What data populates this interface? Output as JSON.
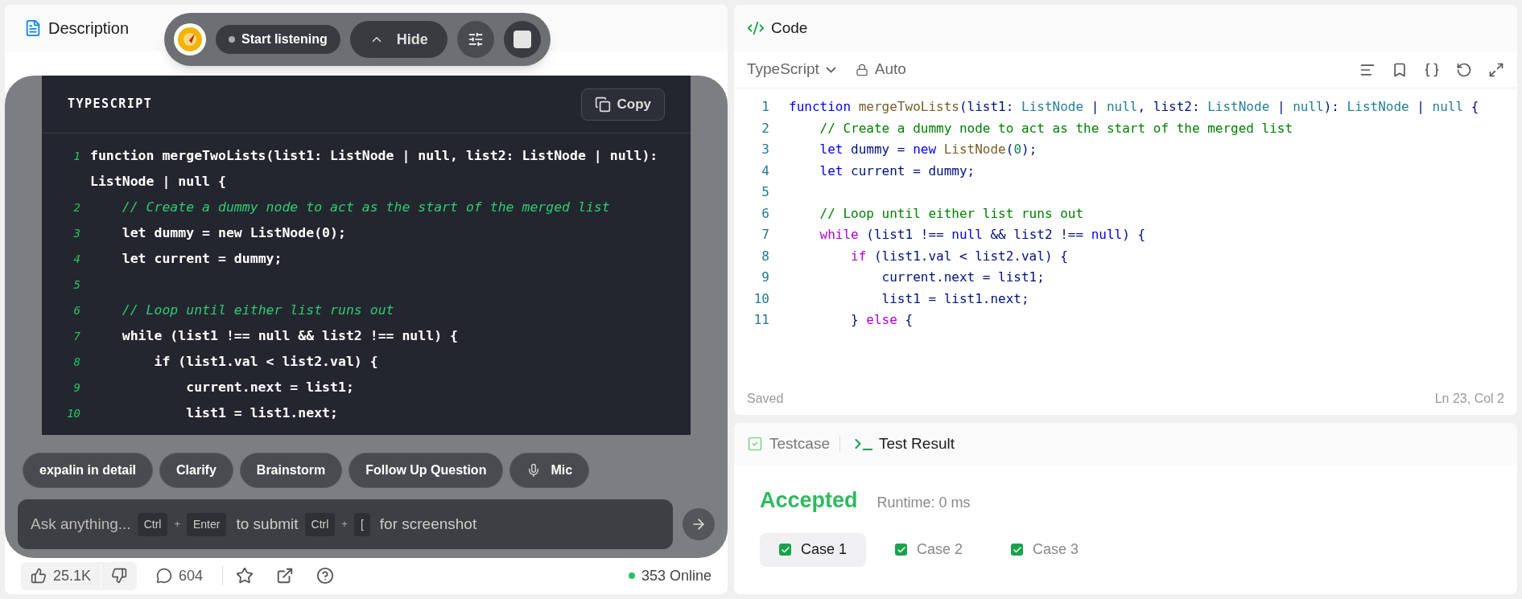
{
  "description_panel": {
    "tabs": [
      {
        "label": "Description",
        "selected": true
      }
    ],
    "footer": {
      "likes": "25.1K",
      "comments": "604",
      "online": "353 Online"
    }
  },
  "assistant": {
    "toolbar": {
      "listen_button": "Start listening",
      "hide_button": "Hide"
    },
    "code_block": {
      "language": "TYPESCRIPT",
      "copy_button": "Copy",
      "lines": [
        {
          "num": "1",
          "text": "function mergeTwoLists(list1: ListNode | null, list2: ListNode | null): ListNode | null {",
          "kind": "code"
        },
        {
          "num": "2",
          "text": "    // Create a dummy node to act as the start of the merged list",
          "kind": "comment"
        },
        {
          "num": "3",
          "text": "    let dummy = new ListNode(0);",
          "kind": "code"
        },
        {
          "num": "4",
          "text": "    let current = dummy;",
          "kind": "code"
        },
        {
          "num": "5"
        },
        {
          "num": "6",
          "text": "    // Loop until either list runs out",
          "kind": "comment"
        },
        {
          "num": "7",
          "text": "    while (list1 !== null && list2 !== null) {",
          "kind": "code"
        },
        {
          "num": "8",
          "text": "        if (list1.val < list2.val) {",
          "kind": "code"
        },
        {
          "num": "9",
          "text": "            current.next = list1;",
          "kind": "code"
        },
        {
          "num": "10",
          "text": "            list1 = list1.next;",
          "kind": "code"
        }
      ]
    },
    "chips": [
      {
        "label": "expalin in detail",
        "kind": "text"
      },
      {
        "label": "Clarify",
        "kind": "text"
      },
      {
        "label": "Brainstorm",
        "kind": "text"
      },
      {
        "label": "Follow Up Question",
        "kind": "text"
      },
      {
        "label": "Mic",
        "kind": "mic"
      }
    ],
    "input": {
      "placeholder": "Ask anything...",
      "hints": [
        {
          "text": "Ctrl",
          "kind": "key"
        },
        {
          "text": "+",
          "kind": "plus"
        },
        {
          "text": "Enter",
          "kind": "key"
        },
        {
          "text": "to submit",
          "kind": "label"
        },
        {
          "text": "Ctrl",
          "kind": "key"
        },
        {
          "text": "+",
          "kind": "plus"
        },
        {
          "text": "[",
          "kind": "key"
        },
        {
          "text": "for screenshot",
          "kind": "label"
        }
      ]
    }
  },
  "code_panel": {
    "title": "Code",
    "language": "TypeScript",
    "mode": "Auto",
    "lines": [
      {
        "num": "1",
        "tokens": [
          {
            "text": "function ",
            "kind": "kw"
          },
          {
            "text": "mergeTwoLists",
            "kind": "fn"
          },
          {
            "text": "(list1: ",
            "kind": "plain"
          },
          {
            "text": "ListNode",
            "kind": "type"
          },
          {
            "text": " | ",
            "kind": "plain"
          },
          {
            "text": "null",
            "kind": "type"
          },
          {
            "text": ", list2: ",
            "kind": "plain"
          },
          {
            "text": "ListNode",
            "kind": "type"
          },
          {
            "text": " | ",
            "kind": "plain"
          },
          {
            "text": "null",
            "kind": "type"
          },
          {
            "text": "): ",
            "kind": "plain"
          },
          {
            "text": "ListNode",
            "kind": "type"
          },
          {
            "text": " | ",
            "kind": "plain"
          },
          {
            "text": "null",
            "kind": "type"
          },
          {
            "text": " {",
            "kind": "plain"
          }
        ]
      },
      {
        "num": "2",
        "tokens": [
          {
            "text": "    // Create a dummy node to act as the start of the merged list",
            "kind": "comment"
          }
        ]
      },
      {
        "num": "3",
        "tokens": [
          {
            "text": "    let",
            "kind": "kw"
          },
          {
            "text": " dummy = ",
            "kind": "plain"
          },
          {
            "text": "new ",
            "kind": "kw"
          },
          {
            "text": "ListNode",
            "kind": "fn"
          },
          {
            "text": "(",
            "kind": "plain"
          },
          {
            "text": "0",
            "kind": "num"
          },
          {
            "text": ");",
            "kind": "plain"
          }
        ]
      },
      {
        "num": "4",
        "tokens": [
          {
            "text": "    let",
            "kind": "kw"
          },
          {
            "text": " current = dummy;",
            "kind": "plain"
          }
        ]
      },
      {
        "num": "5"
      },
      {
        "num": "6",
        "tokens": [
          {
            "text": "    // Loop until either list runs out",
            "kind": "comment"
          }
        ]
      },
      {
        "num": "7",
        "tokens": [
          {
            "text": "    while",
            "kind": "ctrl"
          },
          {
            "text": " (list1 !== ",
            "kind": "plain"
          },
          {
            "text": "null",
            "kind": "kw"
          },
          {
            "text": " && list2 !== ",
            "kind": "plain"
          },
          {
            "text": "null",
            "kind": "kw"
          },
          {
            "text": ") {",
            "kind": "plain"
          }
        ]
      },
      {
        "num": "8",
        "tokens": [
          {
            "text": "        if",
            "kind": "ctrl"
          },
          {
            "text": " (list1.val < list2.val) {",
            "kind": "plain"
          }
        ]
      },
      {
        "num": "9",
        "tokens": [
          {
            "text": "            current.next = list1;",
            "kind": "plain"
          }
        ]
      },
      {
        "num": "10",
        "tokens": [
          {
            "text": "            list1 = list1.next;",
            "kind": "plain"
          }
        ]
      },
      {
        "num": "11",
        "tokens": [
          {
            "text": "        } ",
            "kind": "plain"
          },
          {
            "text": "else",
            "kind": "ctrl"
          },
          {
            "text": " {",
            "kind": "plain"
          }
        ]
      }
    ],
    "status": "Saved",
    "cursor": "Ln 23, Col 2"
  },
  "result_panel": {
    "tabs": [
      {
        "label": "Testcase",
        "kind": "testcase",
        "selected": false
      },
      {
        "label": "Test Result",
        "kind": "result",
        "selected": true
      }
    ],
    "verdict": "Accepted",
    "runtime": "Runtime: 0 ms",
    "cases": [
      {
        "label": "Case 1",
        "selected": true
      },
      {
        "label": "Case 2",
        "selected": false
      },
      {
        "label": "Case 3",
        "selected": false
      }
    ]
  }
}
